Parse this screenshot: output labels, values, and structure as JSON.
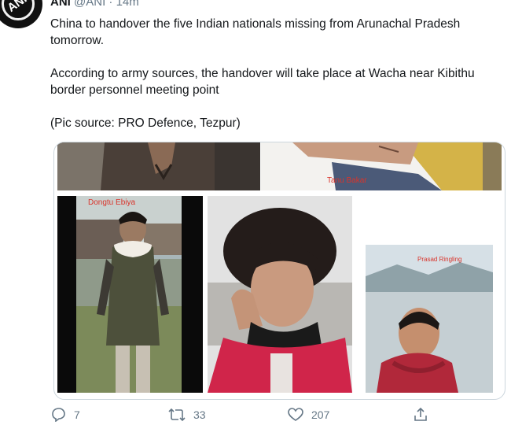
{
  "tweet": {
    "author_name": "ANI",
    "avatar_text": "ANI",
    "handle": "@ANI",
    "separator": "·",
    "time": "14m",
    "paragraphs": [
      "China to handover the five Indian nationals missing from Arunachal Pradesh tomorrow.",
      "According to army sources, the handover will take place at Wacha near Kibithu border personnel meeting point",
      "(Pic source: PRO Defence, Tezpur)"
    ]
  },
  "media": {
    "photo_labels": {
      "tanu": "Tanu Bakar",
      "dongtu": "Dongtu Ebiya",
      "prasad": "Prasad Ringling"
    }
  },
  "actions": {
    "reply_count": "7",
    "retweet_count": "33",
    "like_count": "207"
  },
  "colors": {
    "accent": "#1da1f2",
    "muted": "#657786",
    "label_red": "#d9342b"
  },
  "icons": [
    "reply-icon",
    "retweet-icon",
    "like-icon",
    "share-icon"
  ]
}
